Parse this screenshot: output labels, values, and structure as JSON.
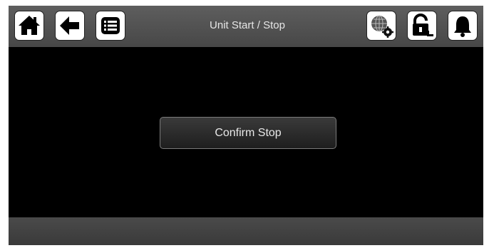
{
  "header": {
    "title": "Unit Start / Stop",
    "buttons": [
      {
        "name": "home",
        "icon": "home-icon"
      },
      {
        "name": "back",
        "icon": "arrow-left-icon"
      },
      {
        "name": "menu",
        "icon": "list-icon"
      },
      {
        "name": "network-settings",
        "icon": "globe-gear-icon"
      },
      {
        "name": "lock",
        "icon": "unlock-icon"
      },
      {
        "name": "alarm",
        "icon": "bell-icon"
      }
    ]
  },
  "main": {
    "confirm_label": "Confirm Stop"
  },
  "colors": {
    "header_bg": "#4f4f4f",
    "screen_bg": "#000000",
    "button_bg": "#2b2b2b",
    "icon_fill": "#000000"
  }
}
